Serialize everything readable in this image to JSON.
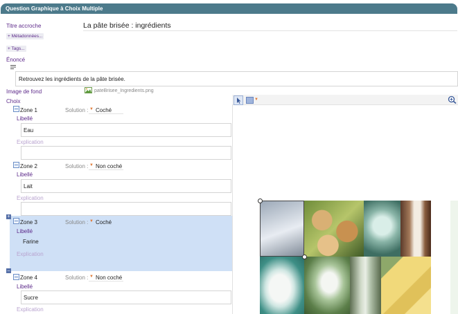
{
  "header": {
    "title": "Question Graphique à Choix Multiple"
  },
  "titre": {
    "label": "Titre accroche",
    "value": "La pâte brisée : ingrédients"
  },
  "buttons": {
    "metadonnees": "+ Métadonnées...",
    "tags": "+ Tags..."
  },
  "enonce": {
    "label": "Énoncé",
    "value": "Retrouvez les ingrédients de la pâte brisée."
  },
  "image_fond": {
    "label": "Image de fond",
    "filename": "pateBrisee_Ingredients.png"
  },
  "choix": {
    "label": "Choix"
  },
  "zones": [
    {
      "title": "Zone 1",
      "solution_label": "Solution :",
      "solution": "Coché",
      "libelle_label": "Libellé",
      "libelle": "Eau",
      "explication_label": "Explication",
      "selected": false
    },
    {
      "title": "Zone 2",
      "solution_label": "Solution :",
      "solution": "Non coché",
      "libelle_label": "Libellé",
      "libelle": "Lait",
      "explication_label": "Explication",
      "selected": false
    },
    {
      "title": "Zone 3",
      "solution_label": "Solution :",
      "solution": "Coché",
      "libelle_label": "Libellé",
      "libelle": "Farine",
      "explication_label": "Explication",
      "selected": true
    },
    {
      "title": "Zone 4",
      "solution_label": "Solution :",
      "solution": "Non coché",
      "libelle_label": "Libellé",
      "libelle": "Sucre",
      "explication_label": "Explication",
      "selected": false
    }
  ],
  "toolbar": {
    "pointer_icon": "cursor-arrow-icon",
    "shape_icon": "rectangle-icon",
    "zoom_icon": "zoom-in-icon"
  },
  "colors": {
    "header": "#4c7a8b",
    "accent": "#5d2a8a",
    "selected_zone": "#cfe0f6",
    "chevron": "#e07b39"
  }
}
